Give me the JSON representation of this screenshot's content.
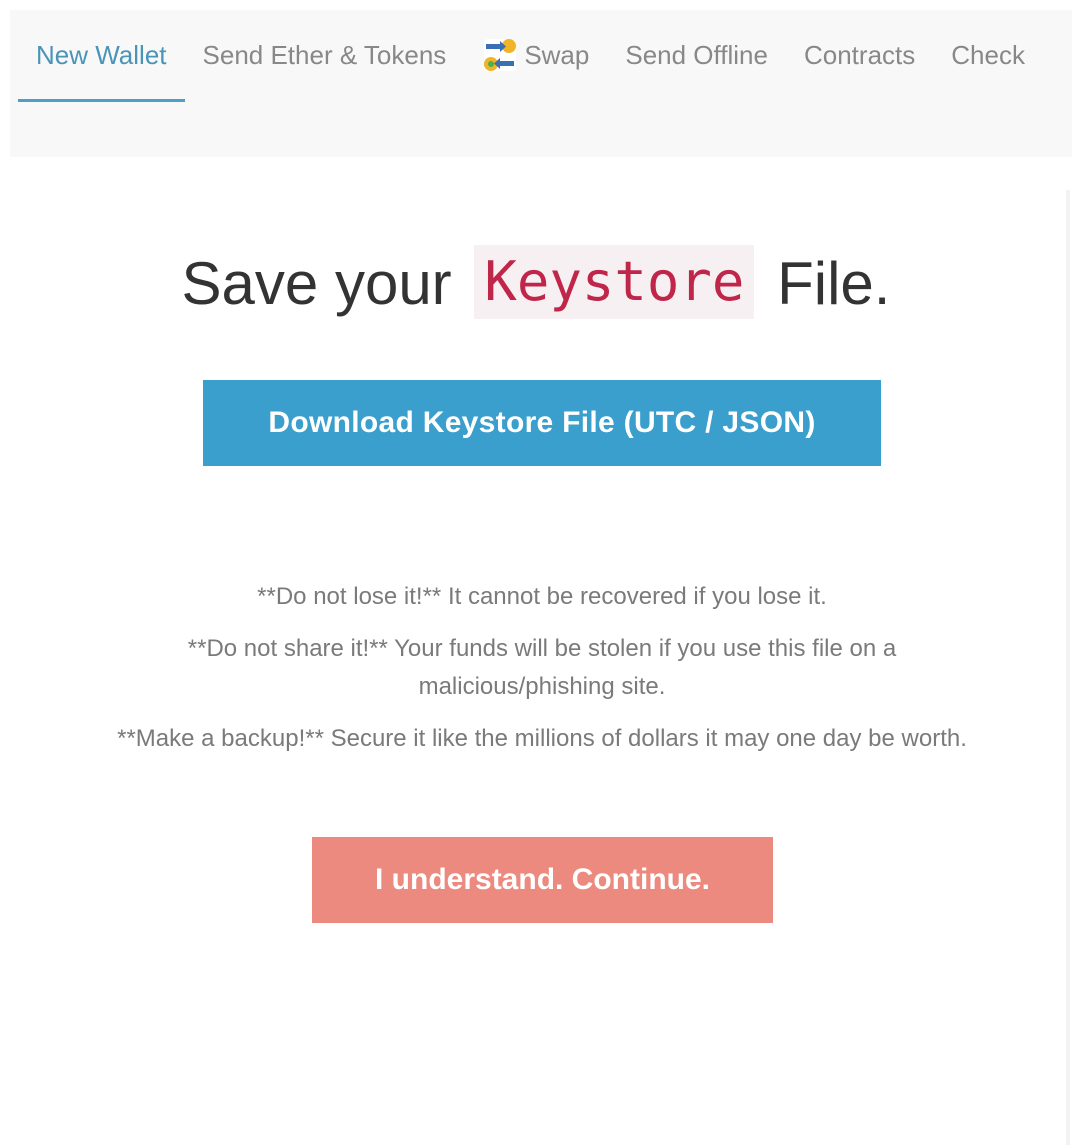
{
  "nav": {
    "tabs": [
      {
        "label": "New Wallet",
        "active": true
      },
      {
        "label": "Send Ether & Tokens"
      },
      {
        "label": "Swap",
        "icon": "swap-icon"
      },
      {
        "label": "Send Offline"
      },
      {
        "label": "Contracts"
      },
      {
        "label": "Check"
      }
    ]
  },
  "heading": {
    "before": "Save your ",
    "code": "Keystore",
    "after": " File."
  },
  "download_button": {
    "label": "Download Keystore File (UTC / JSON)"
  },
  "warnings": [
    "**Do not lose it!** It cannot be recovered if you lose it.",
    "**Do not share it!** Your funds will be stolen if you use this file on a malicious/phishing site.",
    "**Make a backup!** Secure it like the millions of dollars it may one day be worth."
  ],
  "continue_button": {
    "label": "I understand. Continue."
  },
  "colors": {
    "accent": "#3a9fcd",
    "active_tab": "#4a95b7",
    "continue": "#ec8a7f",
    "code": "#c0254a"
  }
}
